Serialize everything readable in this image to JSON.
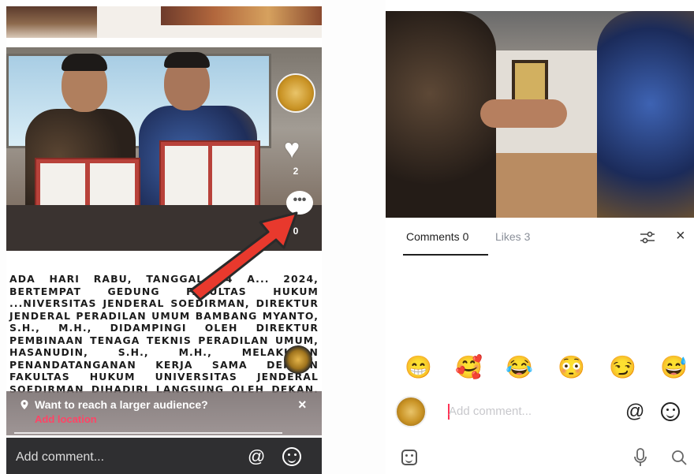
{
  "left_panel": {
    "side_actions": {
      "like_count": "2",
      "comment_icon_glyph": "•••",
      "comment_count": "0"
    },
    "caption": "ADA HARI RABU, TANGGAL 24 A... 2024, BERTEMPAT GEDUNG FAKULTAS HUKUM ...NIVERSITAS JENDERAL SOEDIRMAN, DIREKTUR JENDERAL PERADILAN UMUM BAMBANG MYANTO, S.H., M.H., DIDAMPINGI OLEH DIREKTUR PEMBINAAN TENAGA TEKNIS PERADILAN UMUM, HASANUDIN, S.H., M.H., MELAKUKAN PENANDATANGANAN KERJA SAMA DENGAN FAKULTAS HUKUM UNIVERSITAS JENDERAL SOEDIRMAN DIHADIRI LANGSUNG OLEH DEKAN, PROF. DR. MUHAMMAD FAUZAN, S.H., M.HUM.",
    "location_prompt": {
      "title": "Want to reach a larger audience?",
      "link": "Add location",
      "close": "×"
    },
    "bottom_bar": {
      "placeholder": "Add comment...",
      "at_symbol": "@"
    }
  },
  "right_panel": {
    "tabs": {
      "comments": "Comments 0",
      "likes": "Likes 3",
      "close": "×"
    },
    "emojis": [
      "😁",
      "🥰",
      "😂",
      "😳",
      "😏",
      "😅"
    ],
    "input": {
      "placeholder": "Add comment...",
      "at_symbol": "@"
    }
  },
  "colors": {
    "accent_red": "#ff3355",
    "arrow_red": "#e8392d",
    "dark_bar": "#2f2f31"
  },
  "icons": [
    "heart-icon",
    "comment-icon",
    "location-pin-icon",
    "close-icon",
    "at-icon",
    "emoji-icon",
    "filter-icon",
    "sticker-icon",
    "microphone-icon",
    "search-icon"
  ]
}
